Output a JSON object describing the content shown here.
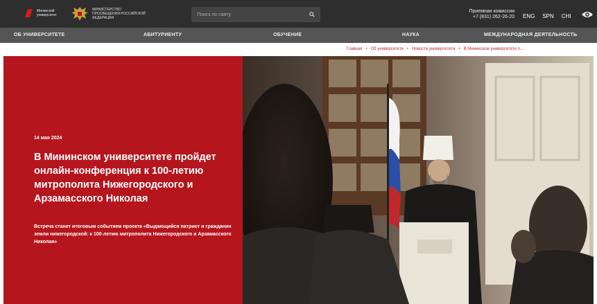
{
  "header": {
    "logo1_text": "Мининский университет",
    "logo2_text": "Министерство просвещения Российской Федерации",
    "search_placeholder": "Поиск по сайту",
    "admission_title": "Приемная комиссия",
    "admission_phone": "+7 (831) 262-26-20",
    "languages": [
      "ENG",
      "SPN",
      "CHI"
    ]
  },
  "nav": {
    "items": [
      "Об университете",
      "Абитуриенту",
      "Обучение",
      "Наука",
      "Международная деятельность"
    ]
  },
  "breadcrumb": {
    "items": [
      "Главная",
      "Об университете",
      "Новости университета",
      "В Мининском университете п..."
    ]
  },
  "hero": {
    "date": "14 мая 2024",
    "title": "В Мининском университете пройдет онлайн-конференция к 100-летию митрополита Нижегородского и Арзамасского Николая",
    "description": "Встреча станет итоговым событием проекта «Выдающийся патриот и гражданин земли нижегородской: к 100-летию митрополита Нижегородского и Арзамасского Николая»"
  },
  "colors": {
    "topbar": "#2e2e2e",
    "nav": "#555555",
    "accent": "#b5161e"
  }
}
